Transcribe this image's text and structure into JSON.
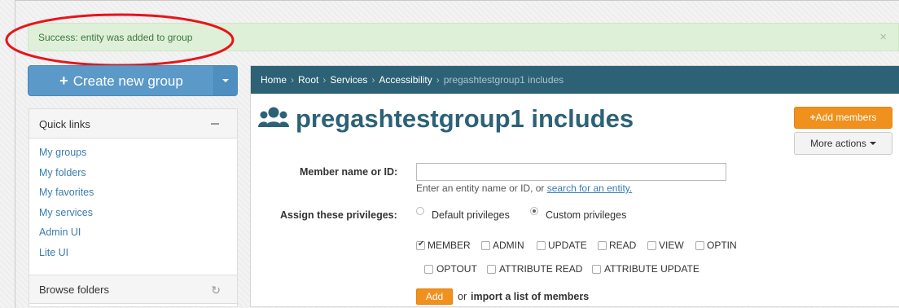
{
  "alert": {
    "message": "Success: entity was added to group",
    "close": "×"
  },
  "create_group": {
    "label": "Create new group",
    "plus": "+"
  },
  "quick_links": {
    "title": "Quick links",
    "items": [
      "My groups",
      "My folders",
      "My favorites",
      "My services",
      "Admin UI",
      "Lite UI"
    ]
  },
  "browse_folders": {
    "title": "Browse folders"
  },
  "breadcrumb": {
    "items": [
      "Home",
      "Root",
      "Services",
      "Accessibility"
    ],
    "current": "pregashtestgroup1 includes",
    "separator": "›"
  },
  "page": {
    "title": "pregashtestgroup1 includes",
    "title_icon": "users-icon"
  },
  "buttons": {
    "add_members": "Add members",
    "add_members_plus": "+",
    "more_actions": "More actions"
  },
  "form": {
    "member_label": "Member name or ID:",
    "member_value": "",
    "help_text": "Enter an entity name or ID, or ",
    "help_link": "search for an entity.",
    "privileges_label": "Assign these privileges:",
    "radio_options": [
      {
        "label": "Default privileges",
        "checked": false
      },
      {
        "label": "Custom privileges",
        "checked": true
      }
    ],
    "privileges": [
      {
        "label": "MEMBER",
        "checked": true
      },
      {
        "label": "ADMIN",
        "checked": false
      },
      {
        "label": "UPDATE",
        "checked": false
      },
      {
        "label": "READ",
        "checked": false
      },
      {
        "label": "VIEW",
        "checked": false
      },
      {
        "label": "OPTIN",
        "checked": false
      },
      {
        "label": "OPTOUT",
        "checked": false
      },
      {
        "label": "ATTRIBUTE READ",
        "checked": false
      },
      {
        "label": "ATTRIBUTE UPDATE",
        "checked": false
      }
    ],
    "add_label": "Add",
    "or_text": "or",
    "import_link": "import a list of members",
    "period": "."
  },
  "colors": {
    "header": "#2d6276",
    "accent": "#f0911e",
    "primary": "#5b99c8",
    "success_bg": "#dff0d8",
    "annotation": "#e8141b"
  }
}
